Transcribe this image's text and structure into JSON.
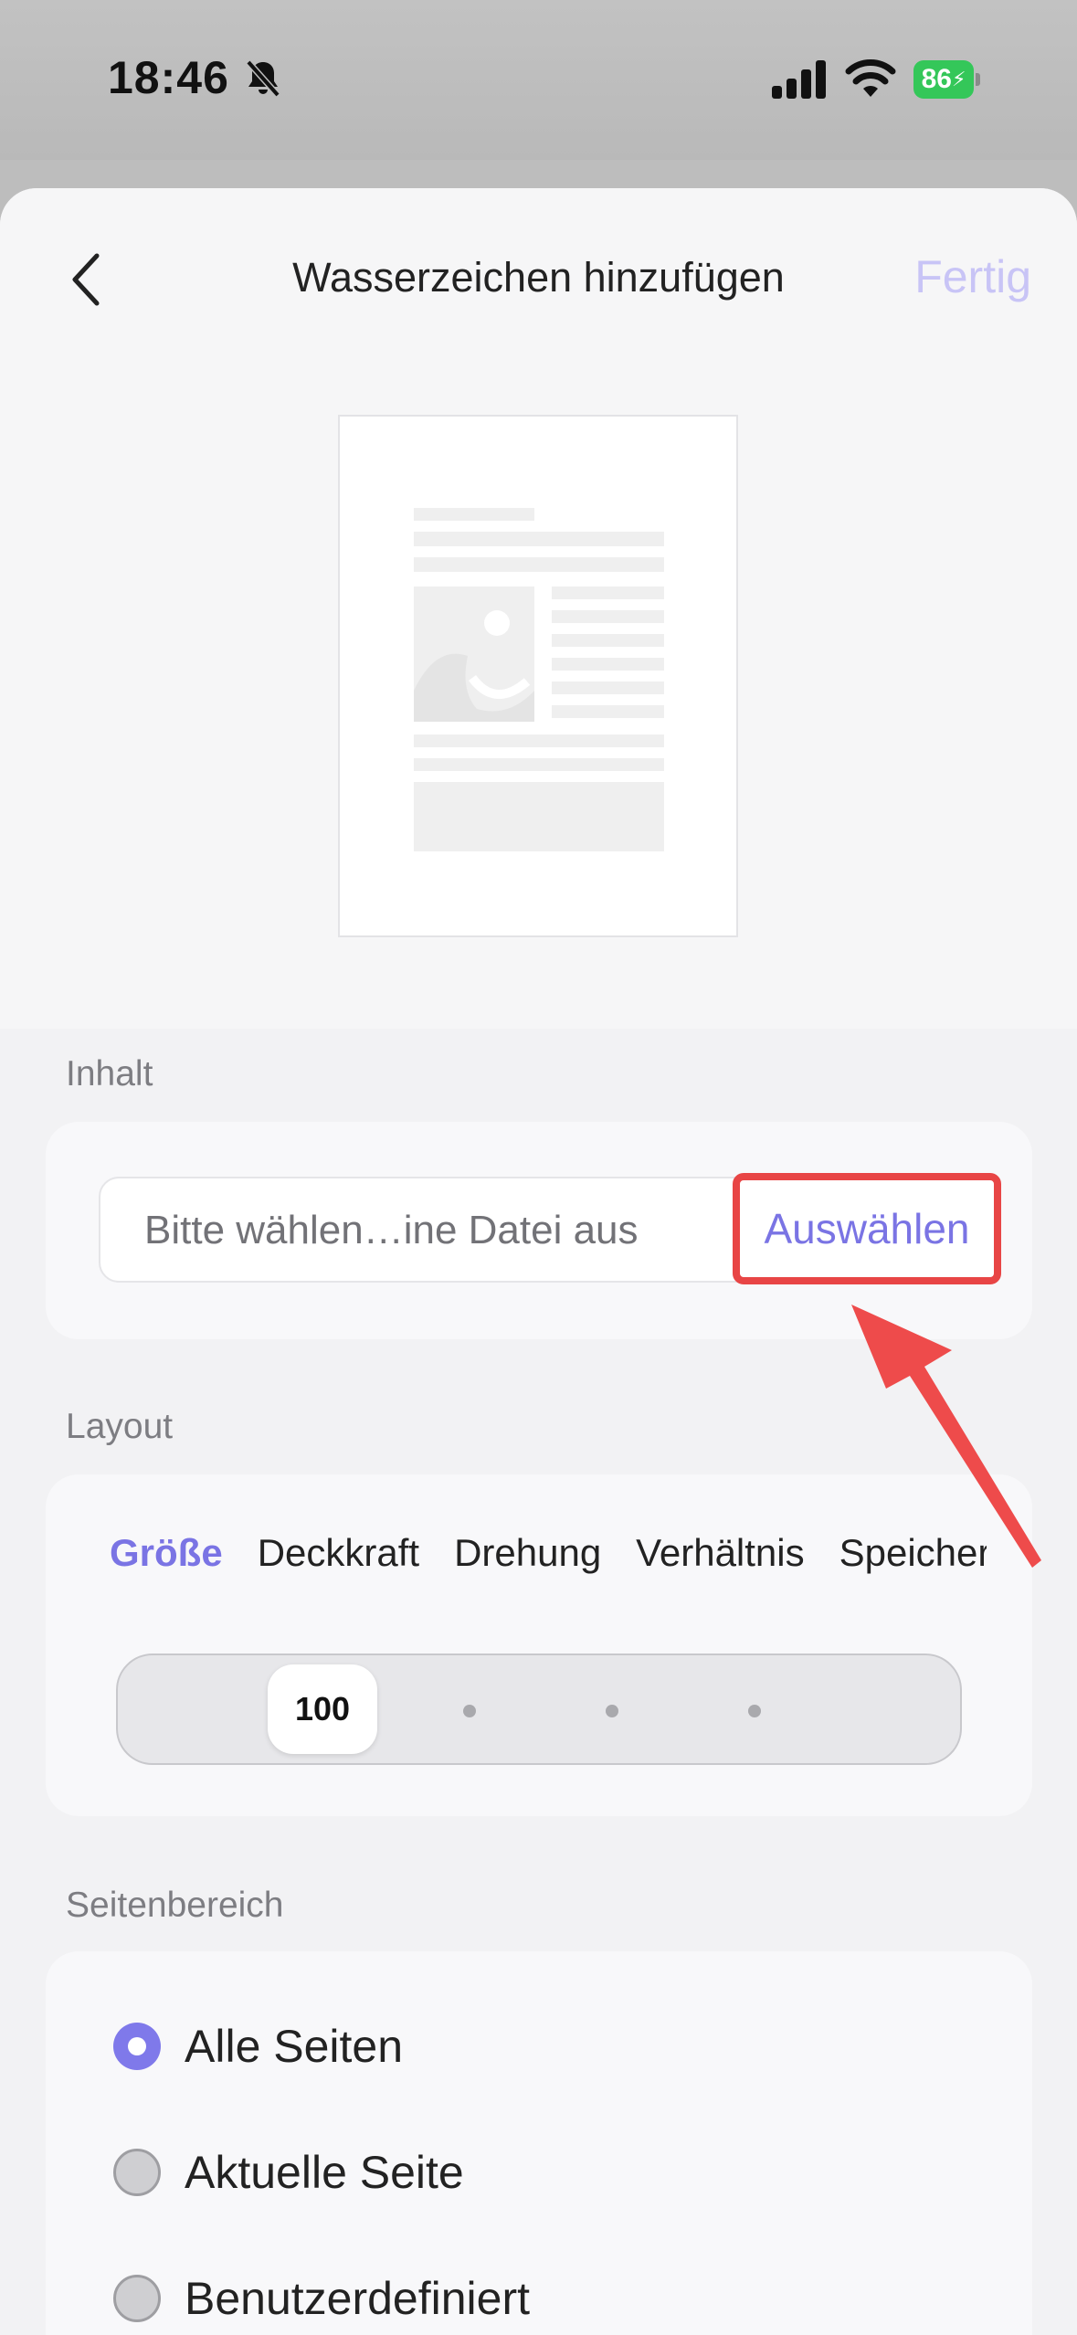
{
  "status_bar": {
    "time": "18:46",
    "battery_level": "86",
    "icons": [
      "bell-slash-icon",
      "cellular-signal-icon",
      "wifi-icon",
      "battery-charging-icon"
    ]
  },
  "header": {
    "title": "Wasserzeichen hinzufügen",
    "done_label": "Fertig",
    "back_icon": "chevron-left-icon"
  },
  "content_section": {
    "label": "Inhalt",
    "file_placeholder": "Bitte wählen…ine Datei aus",
    "choose_label": "Auswählen"
  },
  "layout_section": {
    "label": "Layout",
    "tabs": [
      {
        "label": "Größe",
        "active": true
      },
      {
        "label": "Deckkraft",
        "active": false
      },
      {
        "label": "Drehung",
        "active": false
      },
      {
        "label": "Verhältnis",
        "active": false
      },
      {
        "label": "Speicher",
        "active": false
      }
    ],
    "size_value": "100"
  },
  "page_range_section": {
    "label": "Seitenbereich",
    "options": [
      {
        "label": "Alle Seiten",
        "selected": true
      },
      {
        "label": "Aktuelle Seite",
        "selected": false
      },
      {
        "label": "Benutzerdefiniert",
        "selected": false
      }
    ]
  },
  "colors": {
    "accent": "#7a74e4",
    "highlight_box": "#e84545",
    "battery": "#34c759"
  }
}
